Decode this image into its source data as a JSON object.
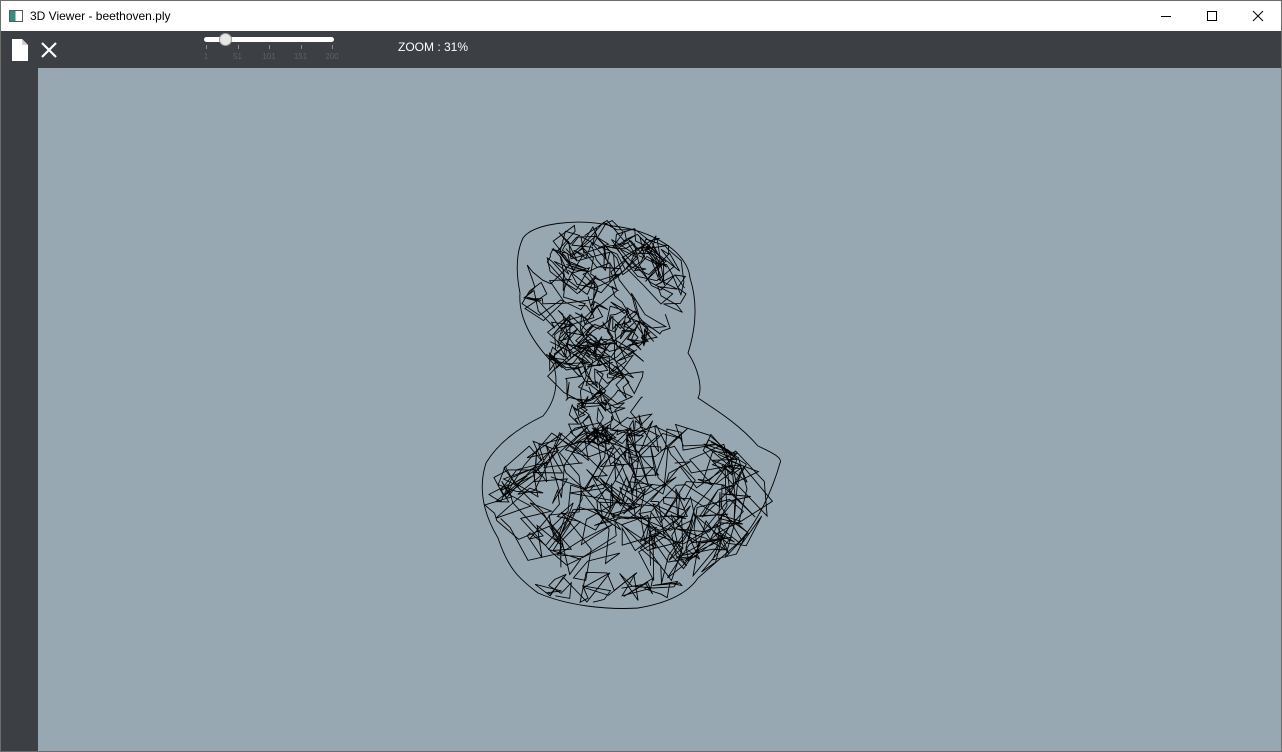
{
  "window": {
    "title": "3D Viewer - beethoven.ply",
    "icon": "app-window-icon"
  },
  "toolbar": {
    "file_icon": "file-icon",
    "close_icon": "close-icon",
    "zoom_slider": {
      "min": 1,
      "max": 200,
      "value": 31,
      "tick_labels": [
        "1",
        "51",
        "101",
        "151",
        "200"
      ]
    },
    "zoom_label": "ZOOM : 31%"
  },
  "viewport": {
    "background": "#98a8b2",
    "model_name": "beethoven.ply",
    "render_mode": "wireframe",
    "wire_color": "#000000"
  },
  "colors": {
    "toolbar_bg": "#3c4044",
    "title_bar_bg": "#ffffff"
  }
}
